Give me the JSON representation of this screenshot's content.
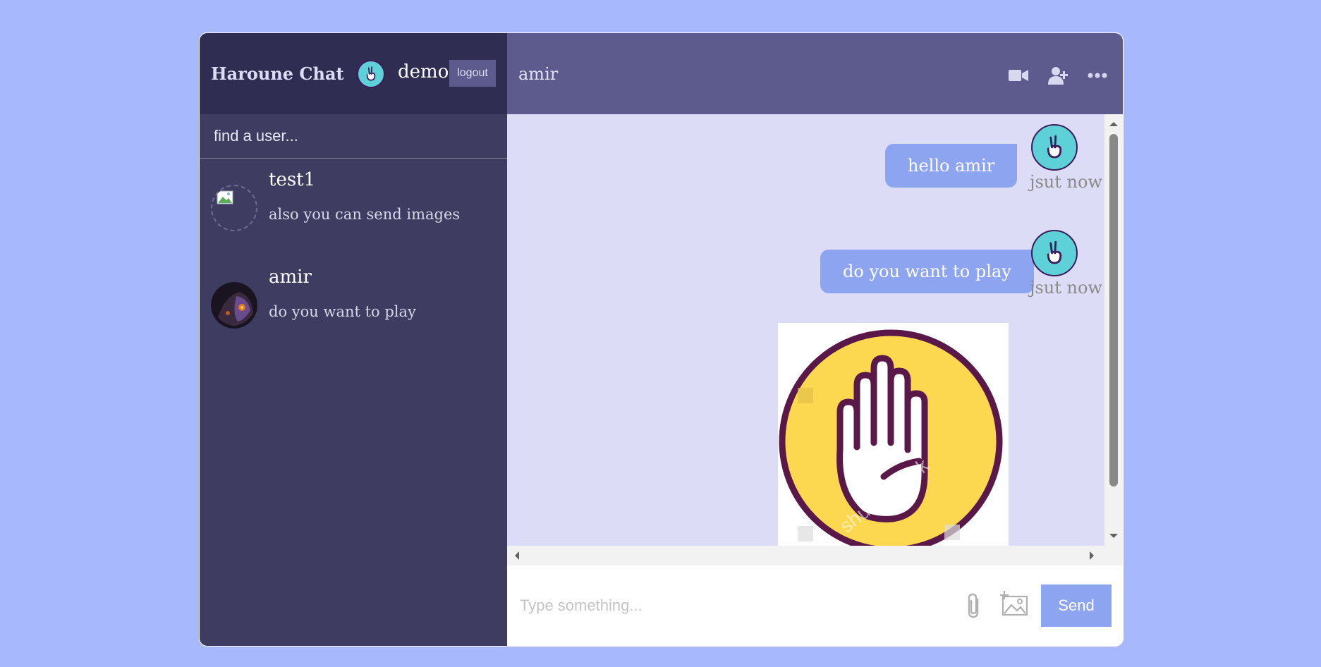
{
  "brand": "Haroune Chat",
  "current_user": {
    "name": "demo",
    "avatar_icon": "peace-hand-icon"
  },
  "logout_label": "logout",
  "search": {
    "placeholder": "find a user..."
  },
  "chats": [
    {
      "name": "test1",
      "last_message": "also you can send images",
      "avatar": "broken-image-icon"
    },
    {
      "name": "amir",
      "last_message": "do you want to play",
      "avatar": "dark-character-avatar"
    }
  ],
  "chat_header": {
    "title": "amir",
    "icons": [
      "video-camera-icon",
      "add-user-icon",
      "more-icon"
    ]
  },
  "messages": [
    {
      "text": "hello amir",
      "time": "jsut now"
    },
    {
      "text": "do you want to play",
      "time": "jsut now"
    }
  ],
  "image_message": {
    "icon": "stop-hand-icon",
    "watermark": "shutterstock"
  },
  "composer": {
    "placeholder": "Type something...",
    "send_label": "Send",
    "icons": [
      "paperclip-icon",
      "add-image-icon"
    ]
  },
  "colors": {
    "page_bg": "#a7b8fc",
    "sidebar": "#3e3c61",
    "sidebar_header": "#2f2d52",
    "chat_header": "#5d5b8d",
    "messages_bg": "#dddcf7",
    "bubble": "#8da4f1"
  }
}
